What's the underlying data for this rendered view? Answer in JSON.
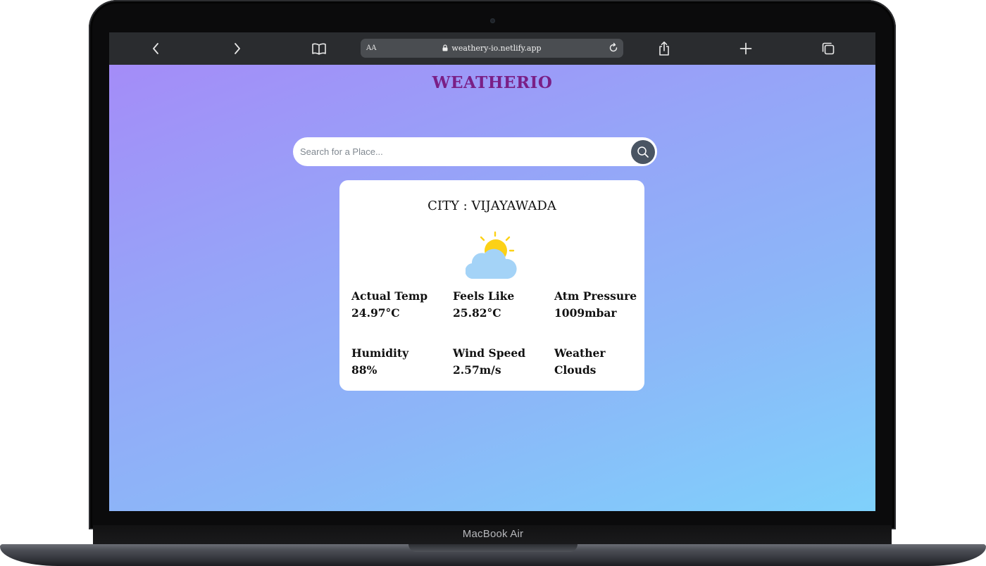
{
  "device": {
    "label": "MacBook Air"
  },
  "browser": {
    "text_size_label": "AA",
    "url": "weathery-io.netlify.app"
  },
  "app": {
    "title": "WEATHERIO",
    "search": {
      "placeholder": "Search for a Place...",
      "value": ""
    },
    "card": {
      "city": "CITY : VIJAYAWADA",
      "weather_icon": "partly-cloudy-icon",
      "stats": [
        {
          "label": "Actual Temp",
          "value": "24.97°C"
        },
        {
          "label": "Feels Like",
          "value": "25.82°C"
        },
        {
          "label": "Atm Pressure",
          "value": "1009mbar"
        },
        {
          "label": "Humidity",
          "value": "88%"
        },
        {
          "label": "Wind Speed",
          "value": "2.57m/s"
        },
        {
          "label": "Weather",
          "value": "Clouds"
        }
      ]
    }
  },
  "colors": {
    "brand": "#7a1f86",
    "gradient_start": "#a48cf8",
    "gradient_end": "#7fd1fb",
    "search_button": "#4a5563",
    "sun": "#fcd116",
    "cloud": "#a4d3f7"
  }
}
